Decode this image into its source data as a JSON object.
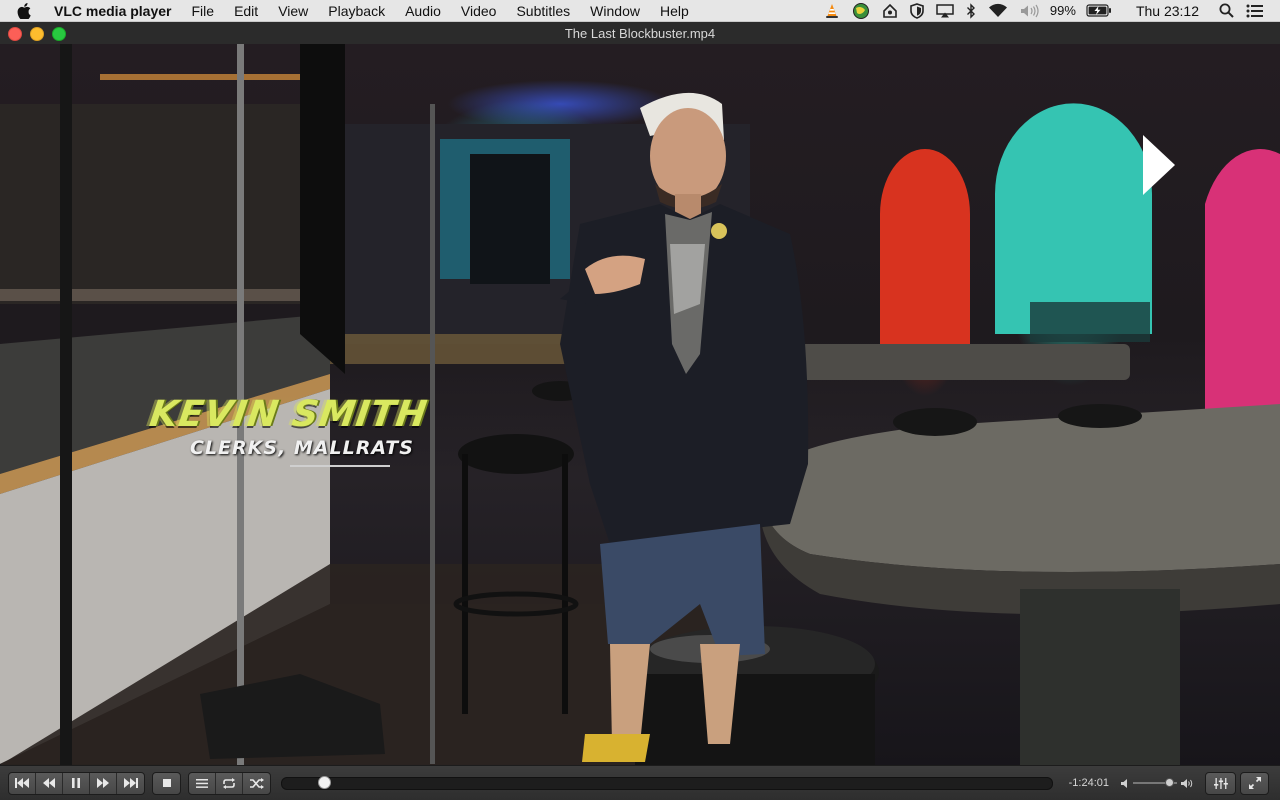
{
  "menubar": {
    "app_name": "VLC media player",
    "items": [
      "File",
      "Edit",
      "View",
      "Playback",
      "Audio",
      "Video",
      "Subtitles",
      "Window",
      "Help"
    ],
    "status": {
      "battery_percent": "99%",
      "clock": "Thu 23:12",
      "icons": [
        "vlc-cone-icon",
        "globe-app-icon",
        "house-app-icon",
        "shield-icon",
        "airplay-icon",
        "bluetooth-icon",
        "wifi-icon",
        "volume-icon",
        "battery-charging-icon",
        "spotlight-search-icon",
        "notification-center-icon"
      ]
    }
  },
  "window": {
    "title": "The Last Blockbuster.mp4"
  },
  "video": {
    "lower_third": {
      "name": "KEVIN SMITH",
      "credits": "CLERKS, MALLRATS"
    },
    "overlay_icon": "play-triangle-icon"
  },
  "controls": {
    "transport": [
      "previous-icon",
      "rewind-icon",
      "pause-icon",
      "fast-forward-icon",
      "next-icon"
    ],
    "stop": "stop-icon",
    "playlist_buttons": [
      "playlist-icon",
      "repeat-icon",
      "shuffle-icon"
    ],
    "position_fraction": 0.037,
    "remaining_time": "-1:24:01",
    "volume_fraction": 0.9,
    "right_buttons": [
      "equalizer-icon",
      "fullscreen-icon"
    ],
    "colors": {
      "bar": "#333333",
      "knob": "#f2f2f2",
      "track": "#1d1d1d"
    }
  }
}
